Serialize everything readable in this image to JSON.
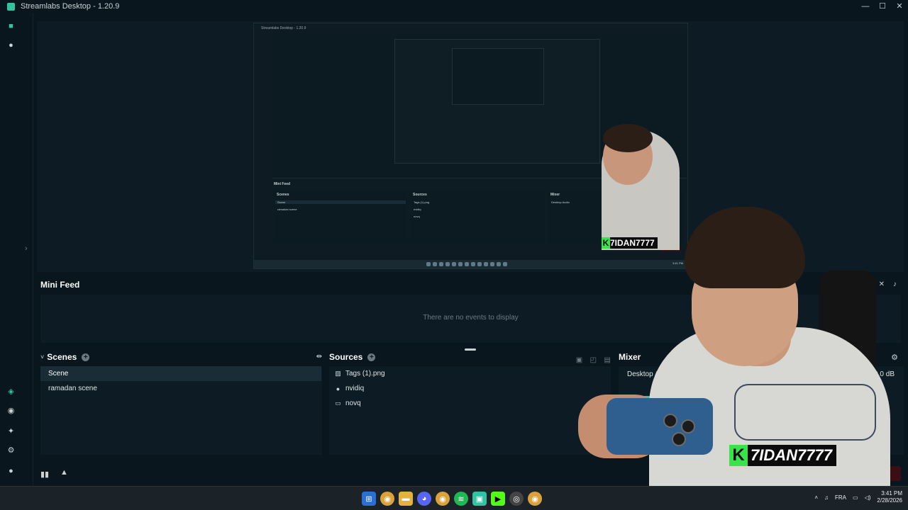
{
  "window": {
    "title": "Streamlabs Desktop - 1.20.9",
    "minimize": "—",
    "maximize": "☐",
    "close": "✕"
  },
  "nav": {
    "items": [
      {
        "name": "editor-icon",
        "glyph": "■"
      },
      {
        "name": "live-dashboard-icon",
        "glyph": "●"
      },
      {
        "name": "themes-icon",
        "glyph": "◈"
      },
      {
        "name": "app-store-icon",
        "glyph": "◉"
      },
      {
        "name": "highlighter-icon",
        "glyph": "✦"
      },
      {
        "name": "settings-icon",
        "glyph": "⚙"
      },
      {
        "name": "profile-icon",
        "glyph": "●"
      }
    ]
  },
  "nested_preview": {
    "title": "Streamlabs Desktop - 1.20.9",
    "mini_feed_title": "Mini Feed",
    "mini_feed_empty": "There are no events to display",
    "scenes_title": "Scenes",
    "scenes": [
      "Scene",
      "ramadan scene"
    ],
    "sources_title": "Sources",
    "sources": [
      "Tags (1).png",
      "nvidiq",
      "novq"
    ],
    "mixer_title": "Mixer",
    "mixer_audio": "Desktop Audio",
    "clock": "3:41 PM",
    "end_stream": "End Stream",
    "tag_text": "7IDAN7777"
  },
  "mini_feed": {
    "title": "Mini Feed",
    "empty_text": "There are no events to display"
  },
  "scenes": {
    "title": "Scenes",
    "items": [
      "Scene",
      "ramadan scene"
    ],
    "selected_index": 0
  },
  "sources": {
    "title": "Sources",
    "items": [
      {
        "label": "Tags (1).png",
        "icon": "image-icon"
      },
      {
        "label": "nvidiq",
        "icon": "webcam-icon"
      },
      {
        "label": "novq",
        "icon": "display-capture-icon"
      }
    ]
  },
  "mixer": {
    "title": "Mixer",
    "device": "Desktop Audio",
    "level": "0.0 dB",
    "meter_fill": 0.1
  },
  "footer": {
    "end_stream": "End Stream"
  },
  "overlay": {
    "tag_text": "7IDAN7777",
    "tag_letter": "K"
  },
  "taskbar": {
    "language": "FRA",
    "time": "3:41 PM",
    "date": "2/28/2026"
  },
  "colors": {
    "accent": "#31c3a2",
    "end_stream": "#ff5a6e",
    "tag_green": "#39e34a"
  }
}
